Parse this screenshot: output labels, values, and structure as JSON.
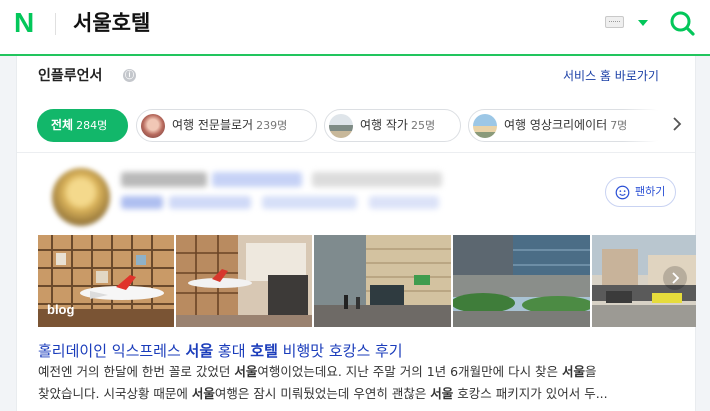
{
  "header": {
    "logo": "N",
    "query": "서울호텔",
    "icons": [
      "keyboard-icon",
      "caret-down-icon",
      "search-icon"
    ],
    "accent_color": "#03c75a"
  },
  "section": {
    "title": "인플루언서",
    "info_icon": "ⓘ",
    "service_link": "서비스 홈 바로가기"
  },
  "chips": [
    {
      "label": "전체",
      "count": "284명",
      "active": true
    },
    {
      "label": "여행 전문블로거",
      "count": "239명",
      "active": false
    },
    {
      "label": "여행 작가",
      "count": "25명",
      "active": false
    },
    {
      "label": "여행 영상크리에이터",
      "count": "7명",
      "active": false
    }
  ],
  "profile": {
    "fan_button": "팬하기"
  },
  "images": {
    "blog_tag": "blog"
  },
  "post": {
    "title_parts": [
      "홀리데이인 익스프레스 ",
      "서울",
      " 홍대 ",
      "호텔",
      " 비행맛 호캉스 후기"
    ],
    "line1_parts": [
      "예전엔 거의 한달에 한번 꼴로 갔었던 ",
      "서울",
      "여행이었는데요. 지난 주말 거의 1년 6개월만에 다시 찾은 ",
      "서울",
      "을"
    ],
    "line2_parts": [
      "찾았습니다. 시국상황 때문에 ",
      "서울",
      "여행은 잠시 미뤄뒀었는데 우연히 괜찮은 ",
      "서울",
      " 호캉스 패키지가 있어서 두..."
    ]
  }
}
